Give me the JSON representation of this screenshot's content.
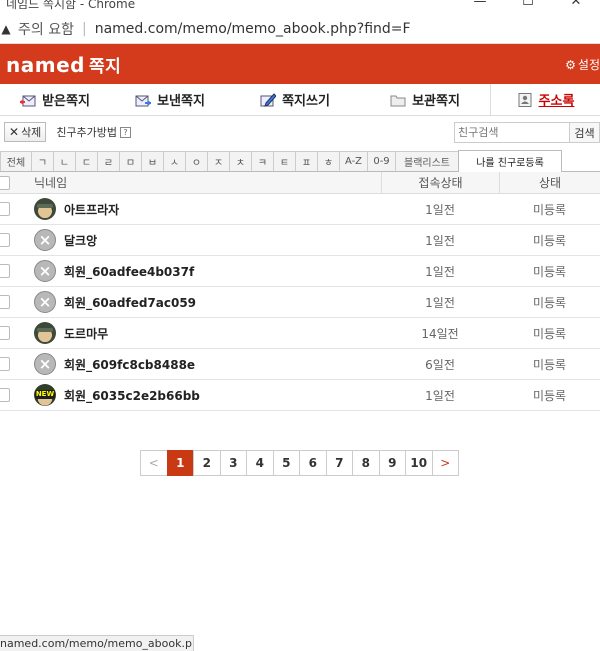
{
  "browser": {
    "window_title": "네임드 쪽지함 - Chrome",
    "security_text": "주의 요함",
    "url": "named.com/memo/memo_abook.php?find=F",
    "status_url": "named.com/memo/memo_abook.p"
  },
  "brand": {
    "logo": "named",
    "logo_sub": "쪽지",
    "settings_label": "설정"
  },
  "tabs": [
    {
      "label": "받은쪽지"
    },
    {
      "label": "보낸쪽지"
    },
    {
      "label": "쪽지쓰기"
    },
    {
      "label": "보관쪽지"
    },
    {
      "label": "주소록"
    }
  ],
  "toolbar": {
    "delete_label": "삭제",
    "howto_label": "친구추가방법",
    "search_placeholder": "친구검색",
    "search_button": "검색"
  },
  "index_tabs": [
    "전체",
    "ㄱ",
    "ㄴ",
    "ㄷ",
    "ㄹ",
    "ㅁ",
    "ㅂ",
    "ㅅ",
    "ㅇ",
    "ㅈ",
    "ㅊ",
    "ㅋ",
    "ㅌ",
    "ㅍ",
    "ㅎ",
    "A-Z",
    "0-9",
    "블랙리스트",
    "나를 친구로등록"
  ],
  "table": {
    "headers": {
      "nickname": "닉네임",
      "connection": "접속상태",
      "status": "상태"
    },
    "rows": [
      {
        "avatar": "helmet",
        "nickname": "아트프라자",
        "connection": "1일전",
        "status": "미등록"
      },
      {
        "avatar": "closed",
        "nickname": "달크앙",
        "connection": "1일전",
        "status": "미등록"
      },
      {
        "avatar": "closed",
        "nickname": "회원_60adfee4b037f",
        "connection": "1일전",
        "status": "미등록"
      },
      {
        "avatar": "closed",
        "nickname": "회원_60adfed7ac059",
        "connection": "1일전",
        "status": "미등록"
      },
      {
        "avatar": "helmet",
        "nickname": "도르마무",
        "connection": "14일전",
        "status": "미등록"
      },
      {
        "avatar": "closed",
        "nickname": "회원_609fc8cb8488e",
        "connection": "6일전",
        "status": "미등록"
      },
      {
        "avatar": "new",
        "nickname": "회원_6035c2e2b66bb",
        "connection": "1일전",
        "status": "미등록"
      }
    ]
  },
  "pagination": {
    "prev": "<",
    "pages": [
      "1",
      "2",
      "3",
      "4",
      "5",
      "6",
      "7",
      "8",
      "9",
      "10"
    ],
    "current": "1",
    "next": ">"
  },
  "colors": {
    "brand_red": "#d43a1c",
    "active_tab": "#c00"
  }
}
